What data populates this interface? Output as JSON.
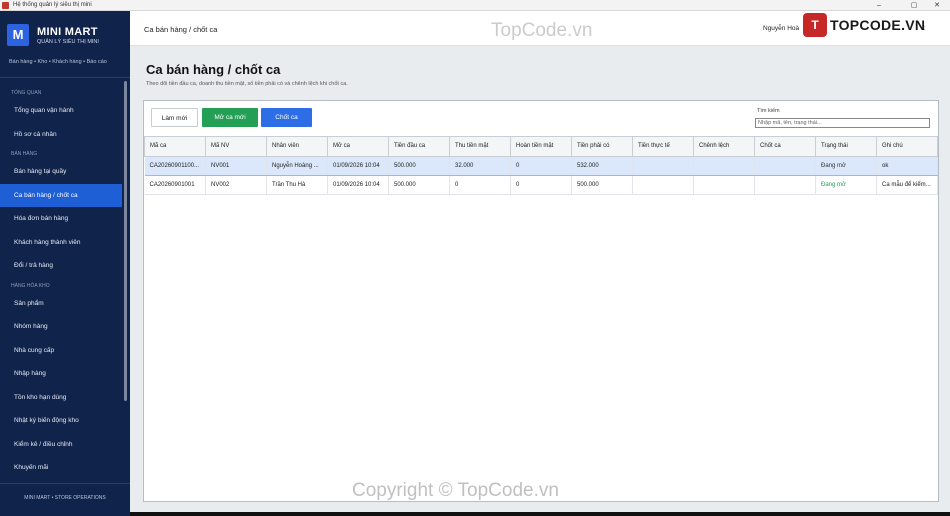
{
  "window": {
    "title": "Hệ thống quản lý siêu thị mini",
    "controls": {
      "minimize": "–",
      "maximize": "▢",
      "close": "✕"
    }
  },
  "sidebar": {
    "logo_letter": "M",
    "brand_name": "MINI MART",
    "brand_sub": "QUẢN LÝ SIÊU THỊ MINI",
    "crumbs": "Bán hàng • Kho • Khách hàng • Báo cáo",
    "sections": [
      {
        "label": "TỔNG QUAN",
        "items": [
          "Tổng quan vận hành",
          "Hồ sơ cá nhân"
        ]
      },
      {
        "label": "BÁN HÀNG",
        "items": [
          "Bán hàng tại quầy",
          "Ca bán hàng / chốt ca",
          "Hóa đơn bán hàng",
          "Khách hàng thành viên",
          "Đổi / trả hàng"
        ]
      },
      {
        "label": "HÀNG HÓA  KHO",
        "items": [
          "Sản phẩm",
          "Nhóm hàng",
          "Nhà cung cấp",
          "Nhập hàng",
          "Tồn kho  hạn dùng",
          "Nhật ký biến động kho",
          "Kiểm kê / điều chỉnh",
          "Khuyến mãi"
        ]
      }
    ],
    "active_item": "Ca bán hàng / chốt ca",
    "footer": "MINI MART • STORE OPERATIONS"
  },
  "header": {
    "page_title": "Ca bán hàng / chốt ca",
    "user_prefix": "Nguyễn Hoà",
    "user_suffix": "t"
  },
  "watermarks": {
    "logo_badge": "T",
    "logo_text": "TOPCODE.VN",
    "top_text": "TopCode.vn",
    "bottom_text": "Copyright © TopCode.vn"
  },
  "main": {
    "title": "Ca bán hàng / chốt ca",
    "description": "Theo dõi tiền đầu ca, doanh thu tiền mặt, số tiền phải có và chênh lệch khi chốt ca.",
    "buttons": {
      "refresh": "Làm mới",
      "open_shift": "Mở ca mới",
      "close_shift": "Chốt ca"
    },
    "search": {
      "label": "Tìm kiếm",
      "placeholder": "Nhập mã, tên, trạng thái..."
    },
    "table": {
      "columns": [
        "Mã ca",
        "Mã NV",
        "Nhân viên",
        "Mở ca",
        "Tiền đầu ca",
        "Thu tiền mặt",
        "Hoàn tiền mặt",
        "Tiền phải có",
        "Tiền thực tế",
        "Chênh lệch",
        "Chốt ca",
        "Trạng thái",
        "Ghi chú"
      ],
      "rows": [
        [
          "CA20260901100...",
          "NV001",
          "Nguyễn Hoàng ...",
          "01/09/2026 10:04",
          "500.000",
          "32.000",
          "0",
          "532.000",
          "",
          "",
          "",
          "Đang mở",
          "ok"
        ],
        [
          "CA20260901001",
          "NV002",
          "Trần Thu Hà",
          "01/09/2026 10:04",
          "500.000",
          "0",
          "0",
          "500.000",
          "",
          "",
          "",
          "Đang mở",
          "Ca mẫu để kiểm..."
        ]
      ],
      "status_colors": [
        "#333333",
        "#23a055"
      ]
    }
  },
  "colors": {
    "sidebar_bg": "#10234b",
    "active_bg": "#1f5fd6",
    "green": "#23a055",
    "blue": "#2d6ee6"
  }
}
